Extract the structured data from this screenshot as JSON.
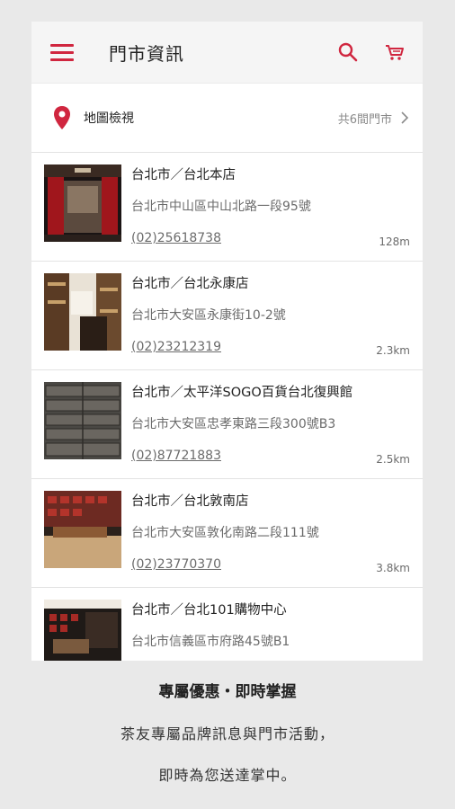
{
  "app_bar": {
    "title": "門市資訊",
    "menu_icon": "hamburger-menu-icon",
    "search_icon": "search-icon",
    "cart_icon": "cart-icon",
    "accent_color": "#d0263f"
  },
  "map_bar": {
    "label": "地圖檢視",
    "store_count": "共6間門市",
    "pin_icon": "location-pin-icon",
    "chevron_icon": "chevron-right-icon"
  },
  "stores": [
    {
      "name": "台北市／台北本店",
      "address": "台北市中山區中山北路一段95號",
      "phone": "(02)25618738",
      "distance": "128m"
    },
    {
      "name": "台北市／台北永康店",
      "address": "台北市大安區永康街10-2號",
      "phone": "(02)23212319",
      "distance": "2.3km"
    },
    {
      "name": "台北市／太平洋SOGO百貨台北復興館",
      "address": "台北市大安區忠孝東路三段300號B3",
      "phone": "(02)87721883",
      "distance": "2.5km"
    },
    {
      "name": "台北市／台北敦南店",
      "address": "台北市大安區敦化南路二段111號",
      "phone": "(02)23770370",
      "distance": "3.8km"
    },
    {
      "name": "台北市／台北101購物中心",
      "address": "台北市信義區市府路45號B1",
      "phone": "",
      "distance": ""
    }
  ],
  "caption": {
    "title": "專屬優惠・即時掌握",
    "line1": "茶友專屬品牌訊息與門市活動，",
    "line2": "即時為您送達掌中。"
  }
}
